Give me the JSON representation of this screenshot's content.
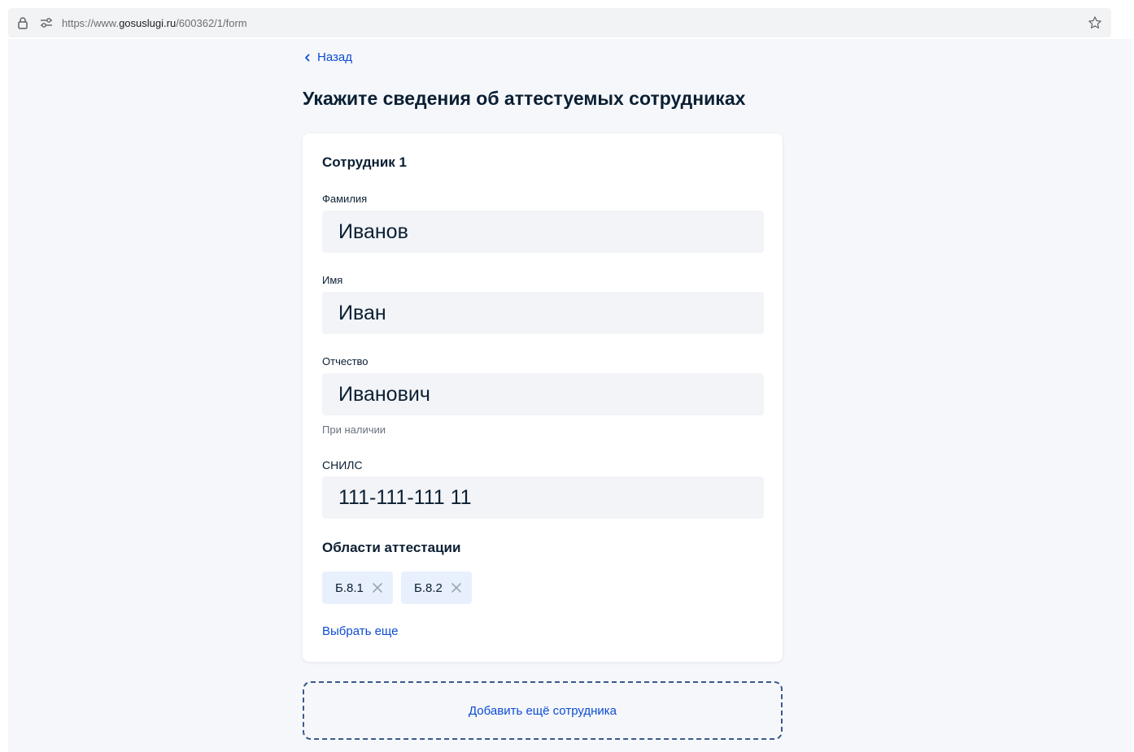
{
  "browser": {
    "url_prefix": "https://www.",
    "url_host": "gosuslugi.ru",
    "url_path": "/600362/1/form",
    "icons": [
      "lock-icon",
      "tune-icon",
      "star-icon"
    ]
  },
  "nav": {
    "back_label": "Назад"
  },
  "page": {
    "title": "Укажите сведения об аттестуемых сотрудниках"
  },
  "employee": {
    "title": "Сотрудник 1",
    "last_name": {
      "label": "Фамилия",
      "value": "Иванов"
    },
    "first_name": {
      "label": "Имя",
      "value": "Иван"
    },
    "patronymic": {
      "label": "Отчество",
      "value": "Иванович",
      "hint": "При наличии"
    },
    "snils": {
      "label": "СНИЛС",
      "value": "111-111-111 11"
    },
    "areas": {
      "title": "Области аттестации",
      "items": [
        "Б.8.1",
        "Б.8.2"
      ],
      "more_label": "Выбрать еще"
    }
  },
  "actions": {
    "add_employee_label": "Добавить ещё сотрудника"
  },
  "colors": {
    "accent": "#0d4cd3",
    "text": "#0b1f33",
    "page_bg": "#f5f7fb",
    "input_bg": "#f2f4f7",
    "chip_bg": "#e8f0fe"
  }
}
